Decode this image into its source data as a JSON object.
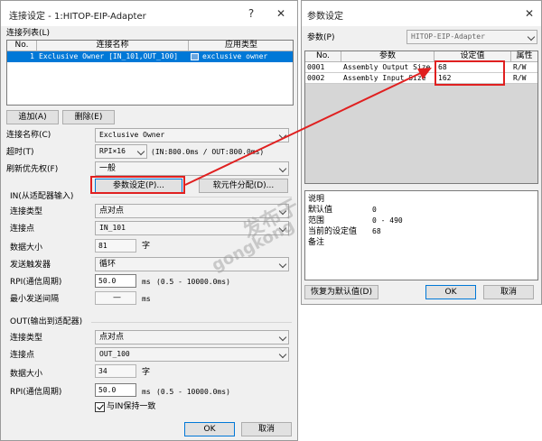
{
  "conn_dialog": {
    "title": "连接设定 - 1:HITOP-EIP-Adapter",
    "help_glyph": "?",
    "close_glyph": "✕",
    "list_label": "连接列表(L)",
    "list_headers": [
      "No.",
      "连接名称",
      "应用类型"
    ],
    "list_rows": [
      {
        "no": "1",
        "name": "Exclusive Owner  [IN_101,OUT_100]",
        "app": "exclusive owner"
      }
    ],
    "add_button": "追加(A)",
    "delete_button": "删除(E)",
    "conn_name_label": "连接名称(C)",
    "conn_name_value": "Exclusive Owner",
    "timeout_label": "超时(T)",
    "timeout_value": "RPI×16",
    "timeout_info": "(IN:800.0ms / OUT:800.0ms)",
    "refresh_label": "刷新优先权(F)",
    "refresh_value": "一般",
    "param_button": "参数设定(P)...",
    "soft_button": "软元件分配(D)...",
    "in_section": "IN(从适配器输入)",
    "in_conn_type_label": "连接类型",
    "in_conn_type_value": "点对点",
    "in_conn_point_label": "连接点",
    "in_conn_point_value": "IN_101",
    "in_data_size_label": "数据大小",
    "in_data_size_value": "81",
    "in_data_unit": "字",
    "send_trigger_label": "发送触发器",
    "send_trigger_value": "循环",
    "in_rpi_label": "RPI(通信周期)",
    "in_rpi_value": "50.0",
    "in_rpi_unit": "ms",
    "in_rpi_range": "(0.5 - 10000.0ms)",
    "min_interval_label": "最小发送间隔",
    "min_interval_value": "—",
    "min_interval_unit": "ms",
    "out_section": "OUT(输出到适配器)",
    "out_conn_type_label": "连接类型",
    "out_conn_type_value": "点对点",
    "out_conn_point_label": "连接点",
    "out_conn_point_value": "OUT_100",
    "out_data_size_label": "数据大小",
    "out_data_size_value": "34",
    "out_data_unit": "字",
    "out_rpi_label": "RPI(通信周期)",
    "out_rpi_value": "50.0",
    "out_rpi_unit": "ms",
    "out_rpi_range": "(0.5 - 10000.0ms)",
    "keep_in_label": "与IN保持一致",
    "ok_button": "OK",
    "cancel_button": "取消"
  },
  "param_dialog": {
    "title": "参数设定",
    "close_glyph": "✕",
    "param_label": "参数(P)",
    "param_value": "HITOP-EIP-Adapter",
    "headers": [
      "No.",
      "参数",
      "设定值",
      "属性"
    ],
    "rows": [
      {
        "no": "0001",
        "param": "Assembly Output Size",
        "value": "68",
        "attr": "R/W"
      },
      {
        "no": "0002",
        "param": "Assembly Input Size",
        "value": "162",
        "attr": "R/W"
      }
    ],
    "desc_title": "说明",
    "default_label": "默认值",
    "default_value": "0",
    "range_label": "范围",
    "range_value": "0 - 490",
    "current_label": "当前的设定值",
    "current_value": "68",
    "note_label": "备注",
    "restore_button": "恢复为默认值(D)",
    "ok_button": "OK",
    "cancel_button": "取消"
  },
  "watermark": {
    "line1": "发布于",
    "line2": "gongkong",
    "mark": "®"
  },
  "colors": {
    "selection": "#0078d7",
    "highlight_box": "#e02020",
    "arrow": "#e02020",
    "dialog_bg": "#f0f0f0"
  }
}
